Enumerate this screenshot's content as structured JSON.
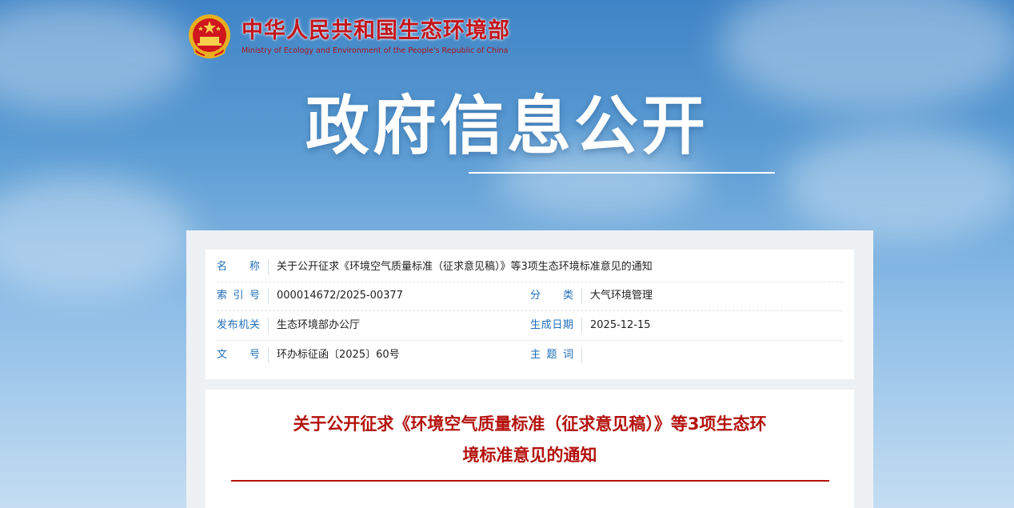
{
  "header": {
    "ministry_cn": "中华人民共和国生态环境部",
    "ministry_en": "Ministry of Ecology and Environment of the People's Republic of China",
    "emblem_icon": "national-emblem-icon"
  },
  "banner": {
    "title": "政府信息公开"
  },
  "meta": {
    "name_label": "名　称",
    "name_value": "关于公开征求《环境空气质量标准（征求意见稿）》等3项生态环境标准意见的通知",
    "index_label": "索 引 号",
    "index_value": "000014672/2025-00377",
    "category_label": "分　类",
    "category_value": "大气环境管理",
    "issuer_label": "发布机关",
    "issuer_value": "生态环境部办公厅",
    "date_label": "生成日期",
    "date_value": "2025-12-15",
    "docno_label": "文　号",
    "docno_value": "环办标征函〔2025〕60号",
    "keywords_label": "主 题 词",
    "keywords_value": ""
  },
  "document": {
    "title_line1": "关于公开征求《环境空气质量标准（征求意见稿）》等3项生态环",
    "title_line2": "境标准意见的通知"
  },
  "colors": {
    "brand_red": "#c4161c",
    "label_blue": "#1f6db9",
    "title_red": "#b3120e"
  }
}
